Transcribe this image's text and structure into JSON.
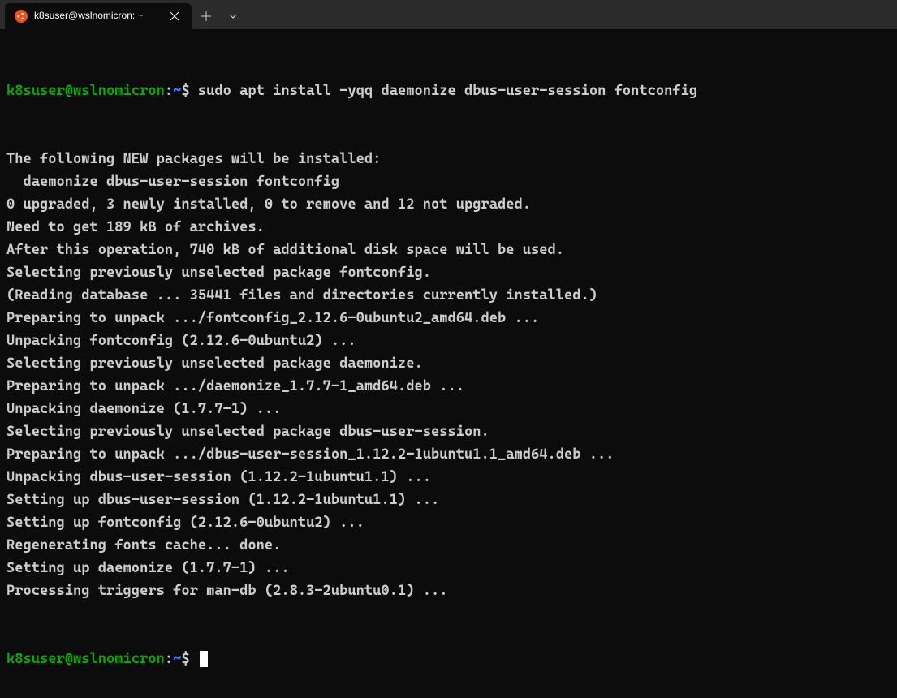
{
  "tab": {
    "title": "k8suser@wslnomicron: ~",
    "icon_name": "ubuntu-icon"
  },
  "prompt": {
    "user_host": "k8suser@wslnomicron",
    "colon": ":",
    "path": "~",
    "dollar": "$"
  },
  "command": "sudo apt install -yqq daemonize dbus-user-session fontconfig",
  "output_lines": [
    "The following NEW packages will be installed:",
    "  daemonize dbus-user-session fontconfig",
    "0 upgraded, 3 newly installed, 0 to remove and 12 not upgraded.",
    "Need to get 189 kB of archives.",
    "After this operation, 740 kB of additional disk space will be used.",
    "Selecting previously unselected package fontconfig.",
    "(Reading database ... 35441 files and directories currently installed.)",
    "Preparing to unpack .../fontconfig_2.12.6-0ubuntu2_amd64.deb ...",
    "Unpacking fontconfig (2.12.6-0ubuntu2) ...",
    "Selecting previously unselected package daemonize.",
    "Preparing to unpack .../daemonize_1.7.7-1_amd64.deb ...",
    "Unpacking daemonize (1.7.7-1) ...",
    "Selecting previously unselected package dbus-user-session.",
    "Preparing to unpack .../dbus-user-session_1.12.2-1ubuntu1.1_amd64.deb ...",
    "Unpacking dbus-user-session (1.12.2-1ubuntu1.1) ...",
    "Setting up dbus-user-session (1.12.2-1ubuntu1.1) ...",
    "Setting up fontconfig (2.12.6-0ubuntu2) ...",
    "Regenerating fonts cache... done.",
    "Setting up daemonize (1.7.7-1) ...",
    "Processing triggers for man-db (2.8.3-2ubuntu0.1) ..."
  ]
}
